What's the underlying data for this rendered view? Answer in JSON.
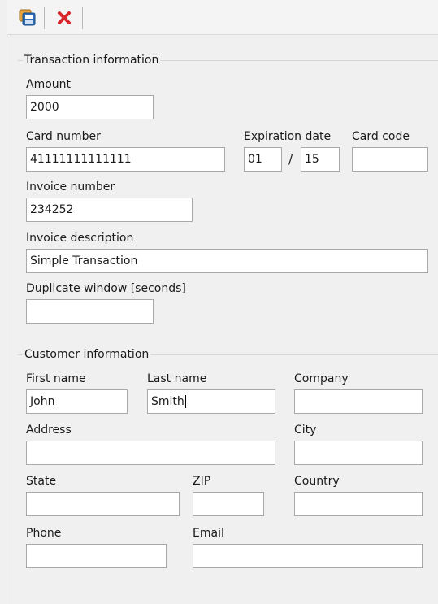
{
  "toolbar": {
    "save_icon": "save-icon",
    "close_icon": "close-icon"
  },
  "transaction": {
    "title": "Transaction information",
    "amount_label": "Amount",
    "amount_value": "2000",
    "card_label": "Card number",
    "card_value": "41111111111111",
    "exp_label": "Expiration date",
    "exp_month": "01",
    "exp_separator": "/",
    "exp_year": "15",
    "card_code_label": "Card code",
    "card_code_value": "",
    "invoice_number_label": "Invoice number",
    "invoice_number_value": "234252",
    "invoice_desc_label": "Invoice description",
    "invoice_desc_value": "Simple Transaction",
    "duplicate_label": "Duplicate window [seconds]",
    "duplicate_value": ""
  },
  "customer": {
    "title": "Customer information",
    "first_name_label": "First name",
    "first_name_value": "John",
    "last_name_label": "Last name",
    "last_name_value": "Smith",
    "company_label": "Company",
    "company_value": "",
    "address_label": "Address",
    "address_value": "",
    "city_label": "City",
    "city_value": "",
    "state_label": "State",
    "state_value": "",
    "zip_label": "ZIP",
    "zip_value": "",
    "country_label": "Country",
    "country_value": "",
    "phone_label": "Phone",
    "phone_value": "",
    "email_label": "Email",
    "email_value": ""
  },
  "colors": {
    "close_red": "#d9262b",
    "save_blue": "#2f6fb7",
    "save_orange": "#e8a33a"
  }
}
